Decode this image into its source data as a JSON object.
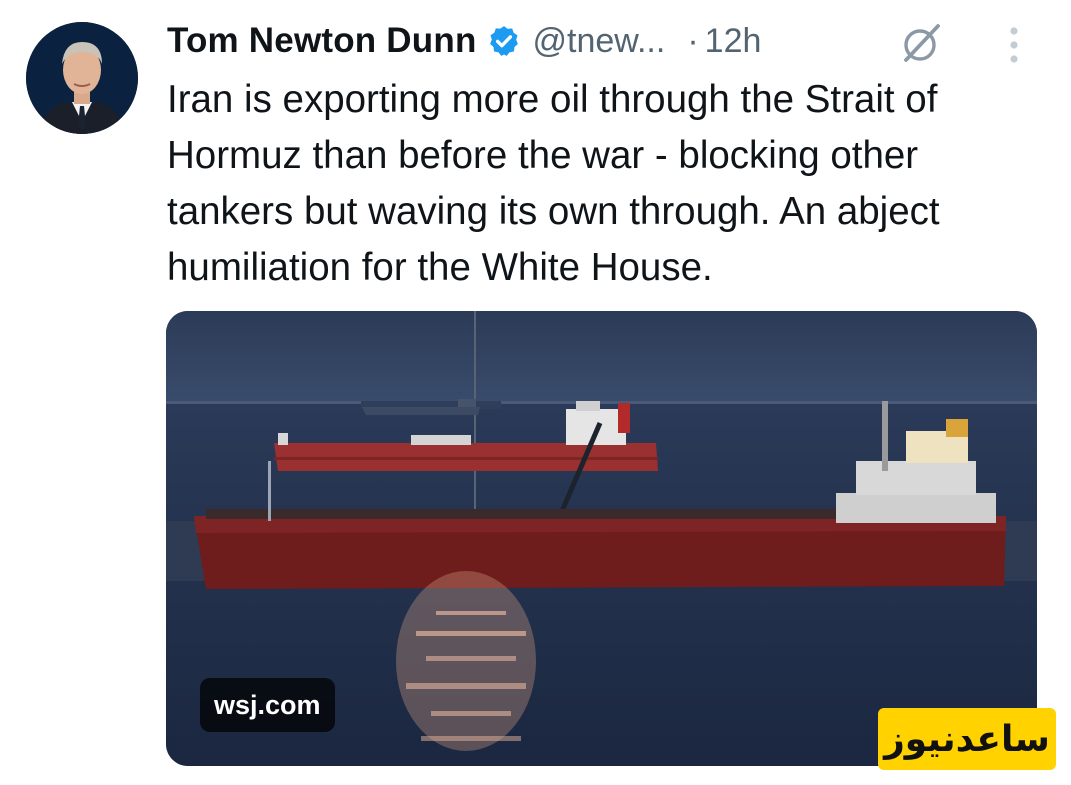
{
  "author": {
    "name": "Tom Newton Dunn",
    "handle": "@tnew...",
    "separator": "·",
    "time": "12h",
    "verified": true,
    "verified_color": "#1d9bf0"
  },
  "tweet": {
    "text": "Iran is exporting more oil through the Strait of Hormuz than before the war - blocking other tankers but waving its own through. An abject humiliation for the White House."
  },
  "media": {
    "description_icon": "photo",
    "source_label": "wsj.com"
  },
  "icons": {
    "grok": "grok-icon",
    "more": "more-options-icon",
    "verified": "verified-badge-icon"
  },
  "watermark": {
    "text": "ساعدنیوز",
    "color": "#ffd200"
  },
  "colors": {
    "text_primary": "#0f1419",
    "text_secondary": "#536471"
  }
}
